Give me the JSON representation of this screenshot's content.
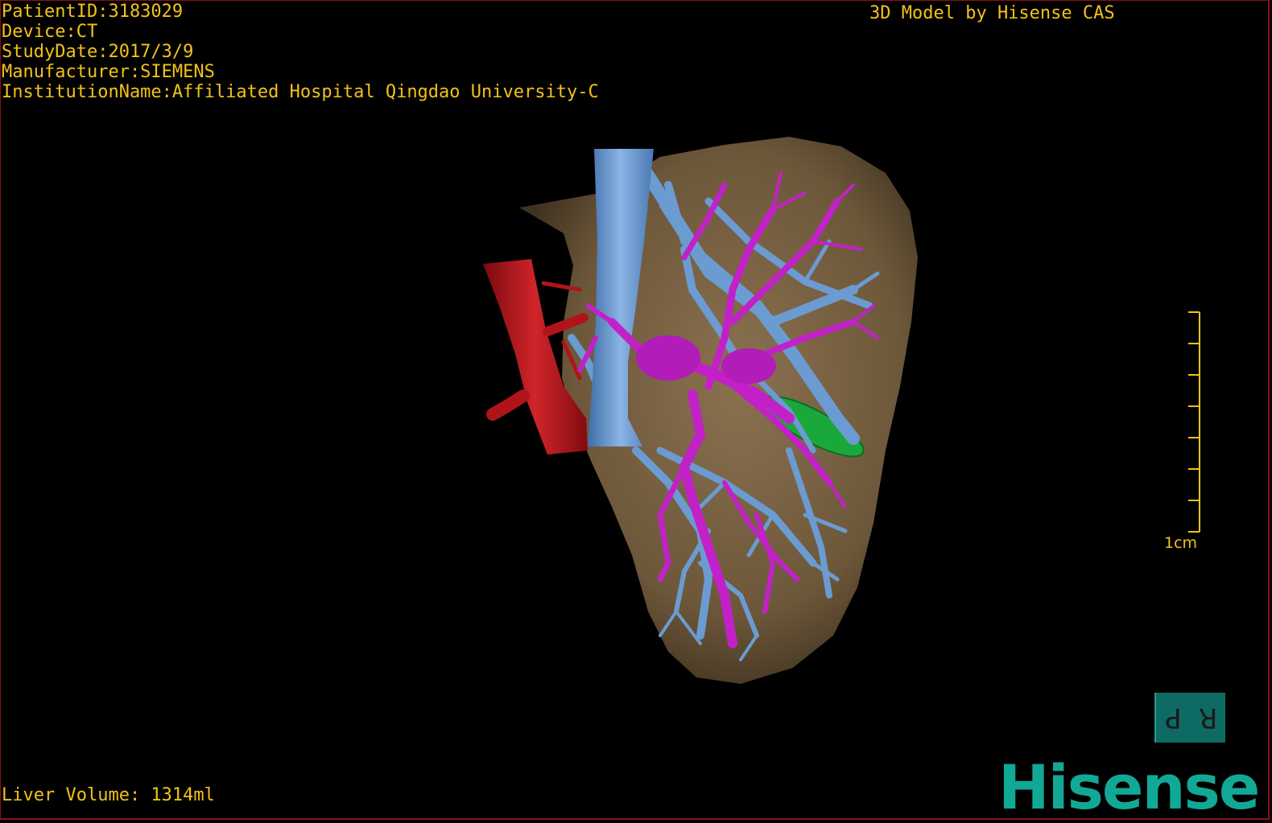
{
  "header": {
    "patient_id": "PatientID:3183029",
    "device": "Device:CT",
    "study_date": "StudyDate:2017/3/9",
    "manufacturer": "Manufacturer:SIEMENS",
    "institution": "InstitutionName:Affiliated Hospital Qingdao University-C"
  },
  "credit": "3D Model by Hisense CAS",
  "footer": {
    "liver_volume": "Liver Volume: 1314ml"
  },
  "scale": {
    "label": "1cm"
  },
  "orientation": {
    "left": "P",
    "right": "R"
  },
  "brand": {
    "logo_text": "Hisense"
  },
  "colors": {
    "text": "#f2c21a",
    "liver": "#7a6242",
    "hepatic_vein": "#6b9bd1",
    "portal_vein": "#c321c8",
    "artery": "#b0141a",
    "lesion": "#1aa83a",
    "brand": "#12a896"
  }
}
